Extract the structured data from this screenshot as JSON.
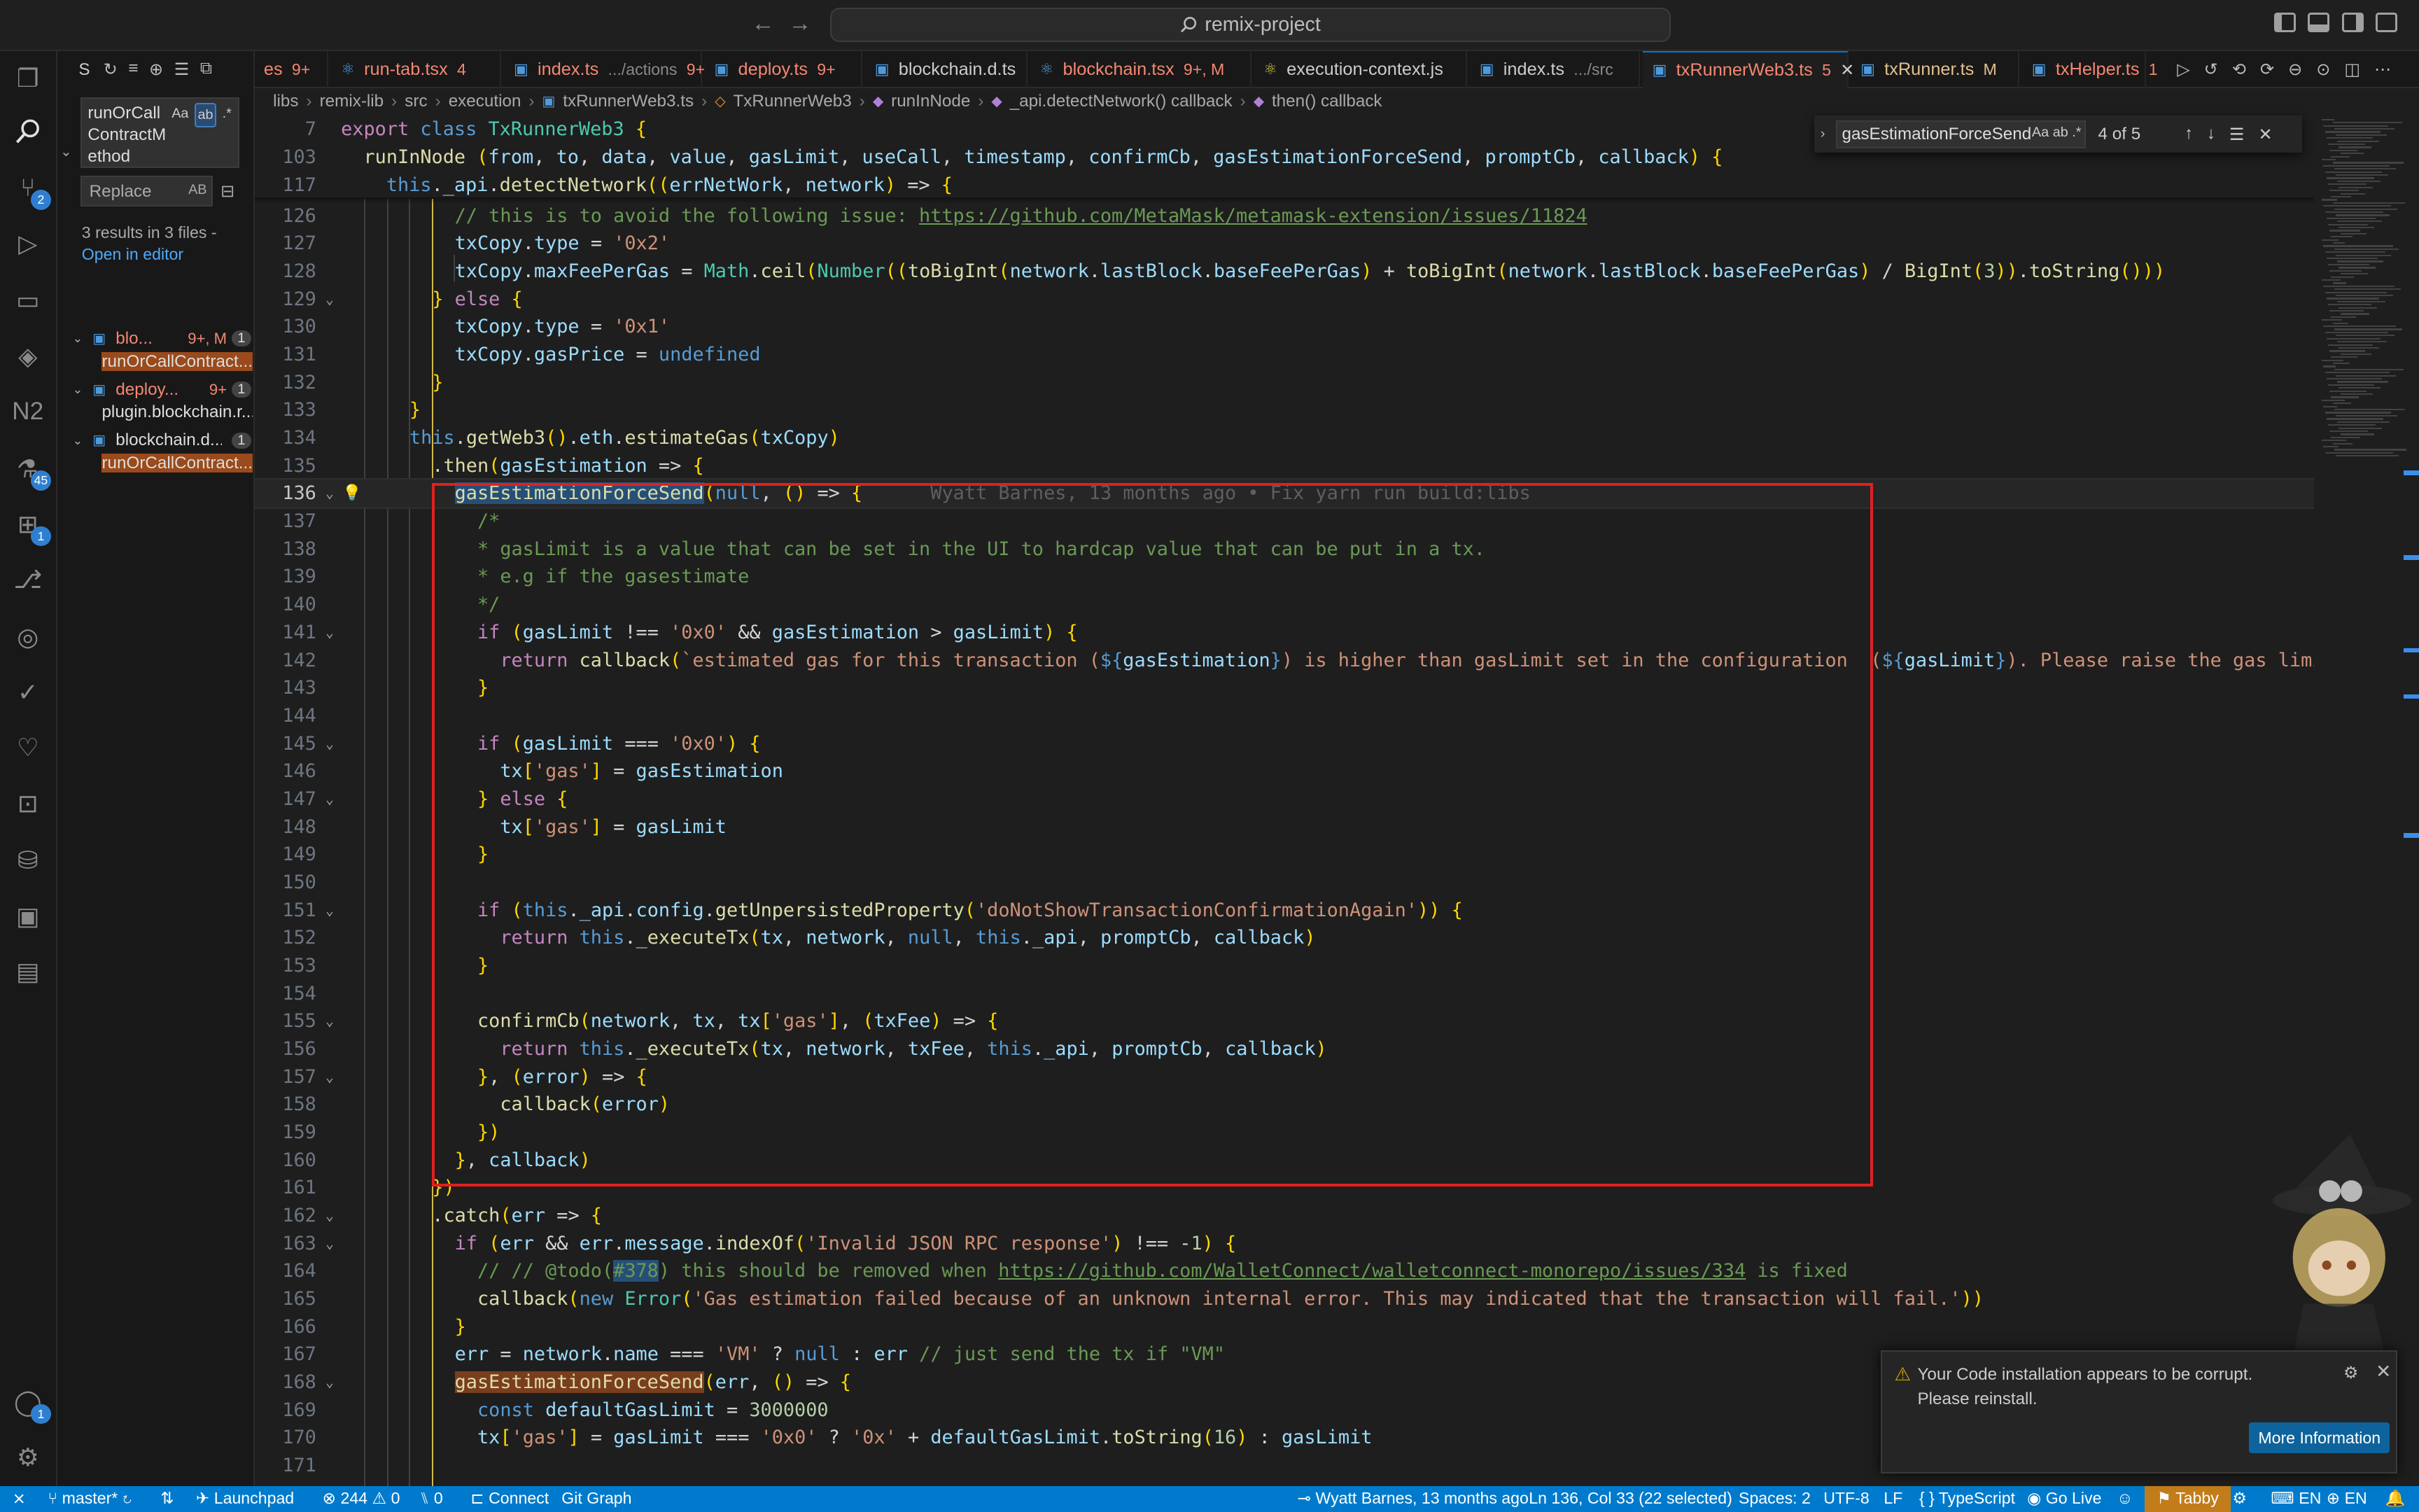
{
  "window": {
    "title": "remix-project",
    "search_icon": "search-icon"
  },
  "activity": {
    "badges": {
      "scm": "2",
      "debug": "45",
      "extensions": "1",
      "accounts": "1"
    }
  },
  "sidebar": {
    "header": "S",
    "search_value": "runOrCallContractMethod",
    "search_line1": "runOrCall",
    "search_line2": "ContractM",
    "search_line3": "ethod",
    "opt_case": "Aa",
    "opt_word": "ab",
    "opt_regex": ".*",
    "replace_placeholder": "Replace",
    "replace_opt": "AB",
    "summary": "3 results in 3 files -",
    "open_editor": "Open in editor",
    "files": [
      {
        "name": "blo...",
        "status": "9+, M",
        "count": "1",
        "match": "runOrCallContract..."
      },
      {
        "name": "deploy...",
        "status": "9+",
        "count": "1",
        "match": "plugin.blockchain.r..."
      },
      {
        "name": "blockchain.d...",
        "status": "",
        "count": "1",
        "match": "runOrCallContract..."
      }
    ]
  },
  "tabs": [
    {
      "label": "es",
      "status": "9+",
      "color": "#f48771"
    },
    {
      "label": "run-tab.tsx",
      "status": "4",
      "color": "#f48771"
    },
    {
      "label": "index.ts",
      "desc": ".../actions",
      "status": "9+",
      "color": "#f48771"
    },
    {
      "label": "deploy.ts",
      "status": "9+",
      "color": "#f48771"
    },
    {
      "label": "blockchain.d.ts",
      "status": "",
      "color": "#cccccc"
    },
    {
      "label": "blockchain.tsx",
      "status": "9+, M",
      "color": "#f48771"
    },
    {
      "label": "execution-context.js",
      "status": "",
      "color": "#cccccc"
    },
    {
      "label": "index.ts",
      "desc": ".../src",
      "status": "",
      "color": "#cccccc"
    },
    {
      "label": "txRunnerWeb3.ts",
      "status": "5",
      "color": "#f48771"
    },
    {
      "label": "txRunner.ts",
      "status": "M",
      "color": "#e2c08d"
    },
    {
      "label": "txHelper.ts",
      "status": "1",
      "color": "#f48771"
    }
  ],
  "breadcrumb": [
    "libs",
    "remix-lib",
    "src",
    "execution",
    "txRunnerWeb3.ts",
    "TxRunnerWeb3",
    "runInNode",
    "_api.detectNetwork() callback",
    "then() callback"
  ],
  "find": {
    "query": "gasEstimationForceSend",
    "case": "Aa",
    "word": "ab",
    "regex": ".*",
    "count": "4 of 5"
  },
  "sticky": [
    {
      "ln": "7",
      "code": "export class TxRunnerWeb3 {"
    },
    {
      "ln": "103",
      "code": "  runInNode (from, to, data, value, gasLimit, useCall, timestamp, confirmCb, gasEstimationForceSend, promptCb, callback) {"
    },
    {
      "ln": "117",
      "code": "    this._api.detectNetwork((errNetWork, network) => {"
    }
  ],
  "code_lines": [
    {
      "ln": "126",
      "text": "        // this is to avoid the following issue: https://github.com/MetaMask/metamask-extension/issues/11824"
    },
    {
      "ln": "127",
      "text": "        txCopy.type = '0x2'"
    },
    {
      "ln": "128",
      "text": "        txCopy.maxFeePerGas = Math.ceil(Number((toBigInt(network.lastBlock.baseFeePerGas) + toBigInt(network.lastBlock.baseFeePerGas) / BigInt(3)).toString()))"
    },
    {
      "ln": "129",
      "text": "      } else {"
    },
    {
      "ln": "130",
      "text": "        txCopy.type = '0x1'"
    },
    {
      "ln": "131",
      "text": "        txCopy.gasPrice = undefined"
    },
    {
      "ln": "132",
      "text": "      }"
    },
    {
      "ln": "133",
      "text": "    }"
    },
    {
      "ln": "134",
      "text": "    this.getWeb3().eth.estimateGas(txCopy)"
    },
    {
      "ln": "135",
      "text": "      .then(gasEstimation => {"
    },
    {
      "ln": "136",
      "text": "        gasEstimationForceSend(null, () => {"
    },
    {
      "ln": "137",
      "text": "          /*"
    },
    {
      "ln": "138",
      "text": "          * gasLimit is a value that can be set in the UI to hardcap value that can be put in a tx."
    },
    {
      "ln": "139",
      "text": "          * e.g if the gasestimate"
    },
    {
      "ln": "140",
      "text": "          */"
    },
    {
      "ln": "141",
      "text": "          if (gasLimit !== '0x0' && gasEstimation > gasLimit) {"
    },
    {
      "ln": "142",
      "text": "            return callback(`estimated gas for this transaction (${gasEstimation}) is higher than gasLimit set in the configuration  (${gasLimit}). Please raise the gas limit"
    },
    {
      "ln": "143",
      "text": "          }"
    },
    {
      "ln": "144",
      "text": ""
    },
    {
      "ln": "145",
      "text": "          if (gasLimit === '0x0') {"
    },
    {
      "ln": "146",
      "text": "            tx['gas'] = gasEstimation"
    },
    {
      "ln": "147",
      "text": "          } else {"
    },
    {
      "ln": "148",
      "text": "            tx['gas'] = gasLimit"
    },
    {
      "ln": "149",
      "text": "          }"
    },
    {
      "ln": "150",
      "text": ""
    },
    {
      "ln": "151",
      "text": "          if (this._api.config.getUnpersistedProperty('doNotShowTransactionConfirmationAgain')) {"
    },
    {
      "ln": "152",
      "text": "            return this._executeTx(tx, network, null, this._api, promptCb, callback)"
    },
    {
      "ln": "153",
      "text": "          }"
    },
    {
      "ln": "154",
      "text": ""
    },
    {
      "ln": "155",
      "text": "          confirmCb(network, tx, tx['gas'], (txFee) => {"
    },
    {
      "ln": "156",
      "text": "            return this._executeTx(tx, network, txFee, this._api, promptCb, callback)"
    },
    {
      "ln": "157",
      "text": "          }, (error) => {"
    },
    {
      "ln": "158",
      "text": "            callback(error)"
    },
    {
      "ln": "159",
      "text": "          })"
    },
    {
      "ln": "160",
      "text": "        }, callback)"
    },
    {
      "ln": "161",
      "text": "      })"
    },
    {
      "ln": "162",
      "text": "      .catch(err => {"
    },
    {
      "ln": "163",
      "text": "        if (err && err.message.indexOf('Invalid JSON RPC response') !== -1) {"
    },
    {
      "ln": "164",
      "text": "          // // @todo(#378) this should be removed when https://github.com/WalletConnect/walletconnect-monorepo/issues/334 is fixed"
    },
    {
      "ln": "165",
      "text": "          callback(new Error('Gas estimation failed because of an unknown internal error. This may indicated that the transaction will fail.'))"
    },
    {
      "ln": "166",
      "text": "        }"
    },
    {
      "ln": "167",
      "text": "        err = network.name === 'VM' ? null : err // just send the tx if \"VM\""
    },
    {
      "ln": "168",
      "text": "        gasEstimationForceSend(err, () => {"
    },
    {
      "ln": "169",
      "text": "          const defaultGasLimit = 3000000"
    },
    {
      "ln": "170",
      "text": "          tx['gas'] = gasLimit === '0x0' ? '0x' + defaultGasLimit.toString(16) : gasLimit"
    },
    {
      "ln": "171",
      "text": ""
    }
  ],
  "blame": "Wyatt Barnes, 13 months ago • Fix yarn run build:libs",
  "notification": {
    "message": "Your Code installation appears to be corrupt. Please reinstall.",
    "button": "More Information"
  },
  "status": {
    "branch": "master*",
    "launchpad": "Launchpad",
    "errors": "244",
    "warnings": "0",
    "ports": "0",
    "connect": "Connect",
    "git_graph": "Git Graph",
    "blame": "Wyatt Barnes, 13 months ago",
    "position": "Ln 136, Col 33 (22 selected)",
    "spaces": "Spaces: 2",
    "encoding": "UTF-8",
    "eol": "LF",
    "language": "TypeScript",
    "golive": "Go Live",
    "tabby": "Tabby",
    "lang1": "EN",
    "lang2": "EN"
  }
}
